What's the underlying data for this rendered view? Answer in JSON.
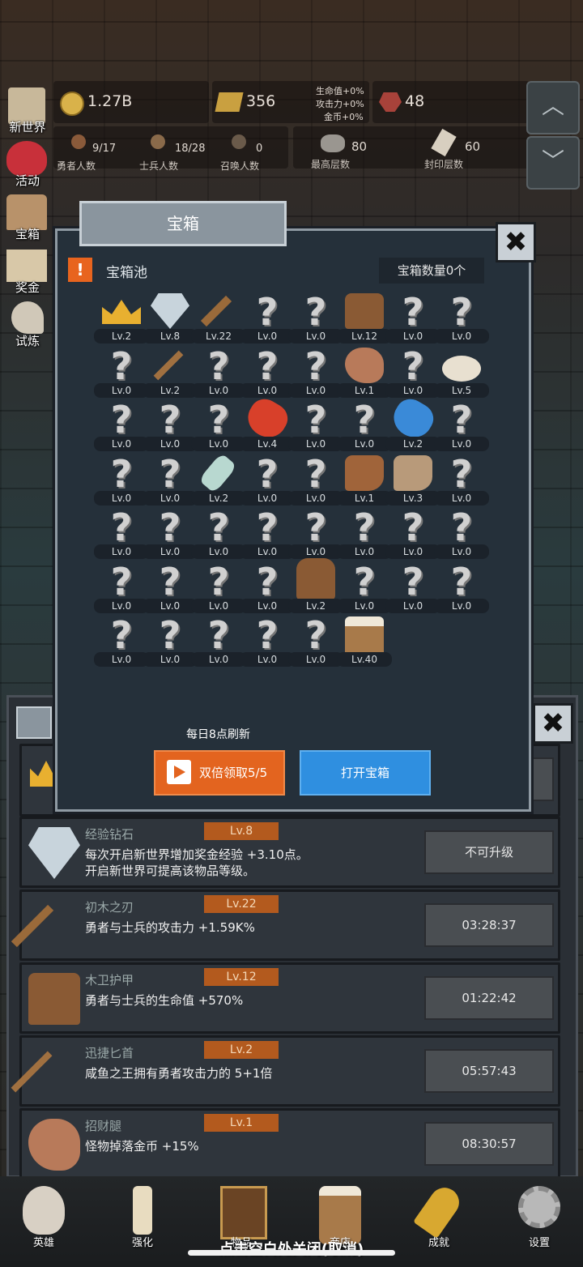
{
  "top": {
    "coins": "1.27B",
    "gold_bars": "356",
    "bonus_hp": "生命值+0%",
    "bonus_atk": "攻击力+0%",
    "bonus_gold": "金币+0%",
    "gems": "48",
    "heroes_val": "9/17",
    "heroes_lbl": "勇者人数",
    "soldiers_val": "18/28",
    "soldiers_lbl": "士兵人数",
    "summon_val": "0",
    "summon_lbl": "召唤人数",
    "max_floor_val": "80",
    "max_floor_lbl": "最高层数",
    "seal_floor_val": "60",
    "seal_floor_lbl": "封印层数"
  },
  "left_nav": [
    "新世界",
    "活动",
    "宝箱",
    "奖金",
    "试炼"
  ],
  "scroll": {
    "up": "︿",
    "down": "﹀"
  },
  "modal": {
    "title": "宝箱",
    "close": "✖",
    "warn": "!",
    "pool_label": "宝箱池",
    "count": "宝箱数量0个",
    "refresh": "每日8点刷新",
    "double_btn": "双倍领取5/5",
    "open_btn": "打开宝箱",
    "items": [
      {
        "type": "crown",
        "lv": "Lv.2"
      },
      {
        "type": "diamond",
        "lv": "Lv.8"
      },
      {
        "type": "sword",
        "lv": "Lv.22"
      },
      {
        "type": "q",
        "lv": "Lv.0"
      },
      {
        "type": "q",
        "lv": "Lv.0"
      },
      {
        "type": "armor",
        "lv": "Lv.12"
      },
      {
        "type": "q",
        "lv": "Lv.0"
      },
      {
        "type": "q",
        "lv": "Lv.0"
      },
      {
        "type": "q",
        "lv": "Lv.0"
      },
      {
        "type": "dagger",
        "lv": "Lv.2"
      },
      {
        "type": "q",
        "lv": "Lv.0"
      },
      {
        "type": "q",
        "lv": "Lv.0"
      },
      {
        "type": "q",
        "lv": "Lv.0"
      },
      {
        "type": "ham",
        "lv": "Lv.1"
      },
      {
        "type": "q",
        "lv": "Lv.0"
      },
      {
        "type": "rice",
        "lv": "Lv.5"
      },
      {
        "type": "q",
        "lv": "Lv.0"
      },
      {
        "type": "q",
        "lv": "Lv.0"
      },
      {
        "type": "q",
        "lv": "Lv.0"
      },
      {
        "type": "redpotion",
        "lv": "Lv.4"
      },
      {
        "type": "q",
        "lv": "Lv.0"
      },
      {
        "type": "q",
        "lv": "Lv.0"
      },
      {
        "type": "bluepotion",
        "lv": "Lv.2"
      },
      {
        "type": "q",
        "lv": "Lv.0"
      },
      {
        "type": "q",
        "lv": "Lv.0"
      },
      {
        "type": "q",
        "lv": "Lv.0"
      },
      {
        "type": "bottle",
        "lv": "Lv.2"
      },
      {
        "type": "q",
        "lv": "Lv.0"
      },
      {
        "type": "q",
        "lv": "Lv.0"
      },
      {
        "type": "boot",
        "lv": "Lv.1"
      },
      {
        "type": "boot2",
        "lv": "Lv.3"
      },
      {
        "type": "q",
        "lv": "Lv.0"
      },
      {
        "type": "q",
        "lv": "Lv.0"
      },
      {
        "type": "q",
        "lv": "Lv.0"
      },
      {
        "type": "q",
        "lv": "Lv.0"
      },
      {
        "type": "q",
        "lv": "Lv.0"
      },
      {
        "type": "q",
        "lv": "Lv.0"
      },
      {
        "type": "q",
        "lv": "Lv.0"
      },
      {
        "type": "q",
        "lv": "Lv.0"
      },
      {
        "type": "q",
        "lv": "Lv.0"
      },
      {
        "type": "q",
        "lv": "Lv.0"
      },
      {
        "type": "q",
        "lv": "Lv.0"
      },
      {
        "type": "q",
        "lv": "Lv.0"
      },
      {
        "type": "q",
        "lv": "Lv.0"
      },
      {
        "type": "backpack",
        "lv": "Lv.2"
      },
      {
        "type": "q",
        "lv": "Lv.0"
      },
      {
        "type": "q",
        "lv": "Lv.0"
      },
      {
        "type": "q",
        "lv": "Lv.0"
      },
      {
        "type": "q",
        "lv": "Lv.0"
      },
      {
        "type": "q",
        "lv": "Lv.0"
      },
      {
        "type": "q",
        "lv": "Lv.0"
      },
      {
        "type": "q",
        "lv": "Lv.0"
      },
      {
        "type": "q",
        "lv": "Lv.0"
      },
      {
        "type": "beer",
        "lv": "Lv.40"
      }
    ]
  },
  "list": [
    {
      "name": "经验钻石",
      "lv": "Lv.8",
      "desc1": "每次开启新世界增加奖金经验 +3.10点。",
      "desc2": "开启新世界可提高该物品等级。",
      "btn": "不可升级",
      "icon": "diamond"
    },
    {
      "name": "初木之刃",
      "lv": "Lv.22",
      "desc1": "勇者与士兵的攻击力 +1.59K%",
      "desc2": "",
      "btn": "03:28:37",
      "icon": "sword"
    },
    {
      "name": "木卫护甲",
      "lv": "Lv.12",
      "desc1": "勇者与士兵的生命值 +570%",
      "desc2": "",
      "btn": "01:22:42",
      "icon": "armor"
    },
    {
      "name": "迅捷匕首",
      "lv": "Lv.2",
      "desc1": "咸鱼之王拥有勇者攻击力的 5+1倍",
      "desc2": "",
      "btn": "05:57:43",
      "icon": "dagger"
    },
    {
      "name": "招财腿",
      "lv": "Lv.1",
      "desc1": "怪物掉落金币 +15%",
      "desc2": "",
      "btn": "08:30:57",
      "icon": "ham"
    }
  ],
  "bottom_nav": [
    "英雄",
    "强化",
    "物品",
    "商店",
    "成就",
    "设置"
  ],
  "close_hint": "点击空白处关闭(取消)"
}
